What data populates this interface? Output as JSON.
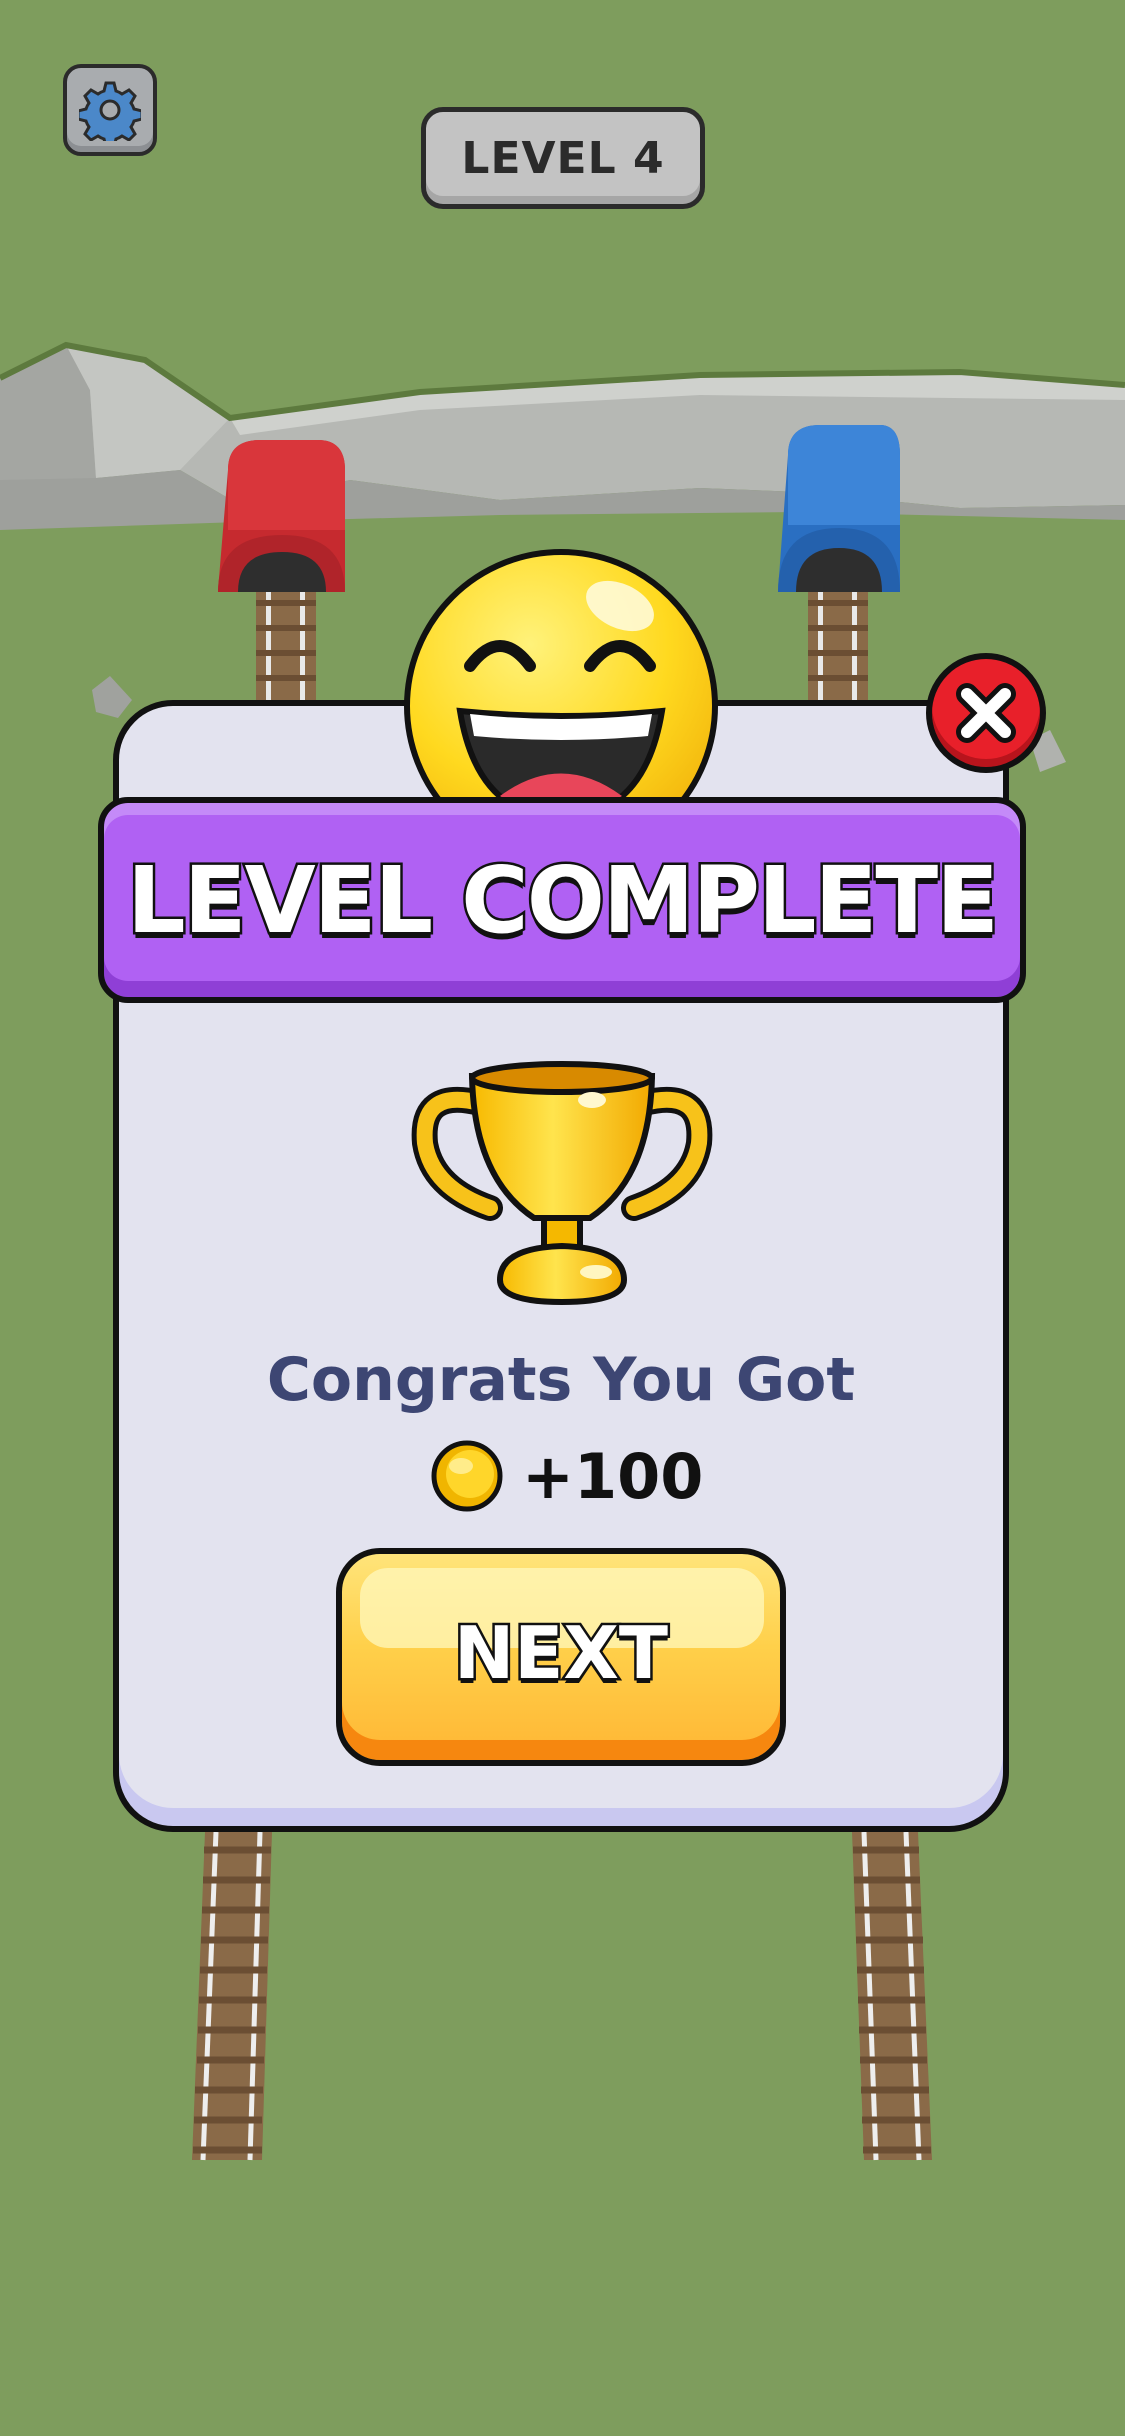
{
  "hud": {
    "settings_icon": "gear-icon",
    "level_label": "LEVEL 4"
  },
  "modal": {
    "title": "LEVEL COMPLETE",
    "close_icon": "close-icon",
    "mascot_icon": "laughing-face-icon",
    "trophy_icon": "trophy-icon",
    "message": "Congrats You Got",
    "reward": {
      "coin_icon": "coin-icon",
      "amount": "+100"
    },
    "next_label": "NEXT"
  },
  "colors": {
    "background": "#7e9d5d",
    "banner": "#b061f3",
    "panel": "#e3e3ef",
    "close": "#e8202a",
    "next_button": "#ffc23e",
    "message_text": "#3d4673",
    "red_tunnel": "#c62a2f",
    "blue_tunnel": "#2a6fc2"
  }
}
